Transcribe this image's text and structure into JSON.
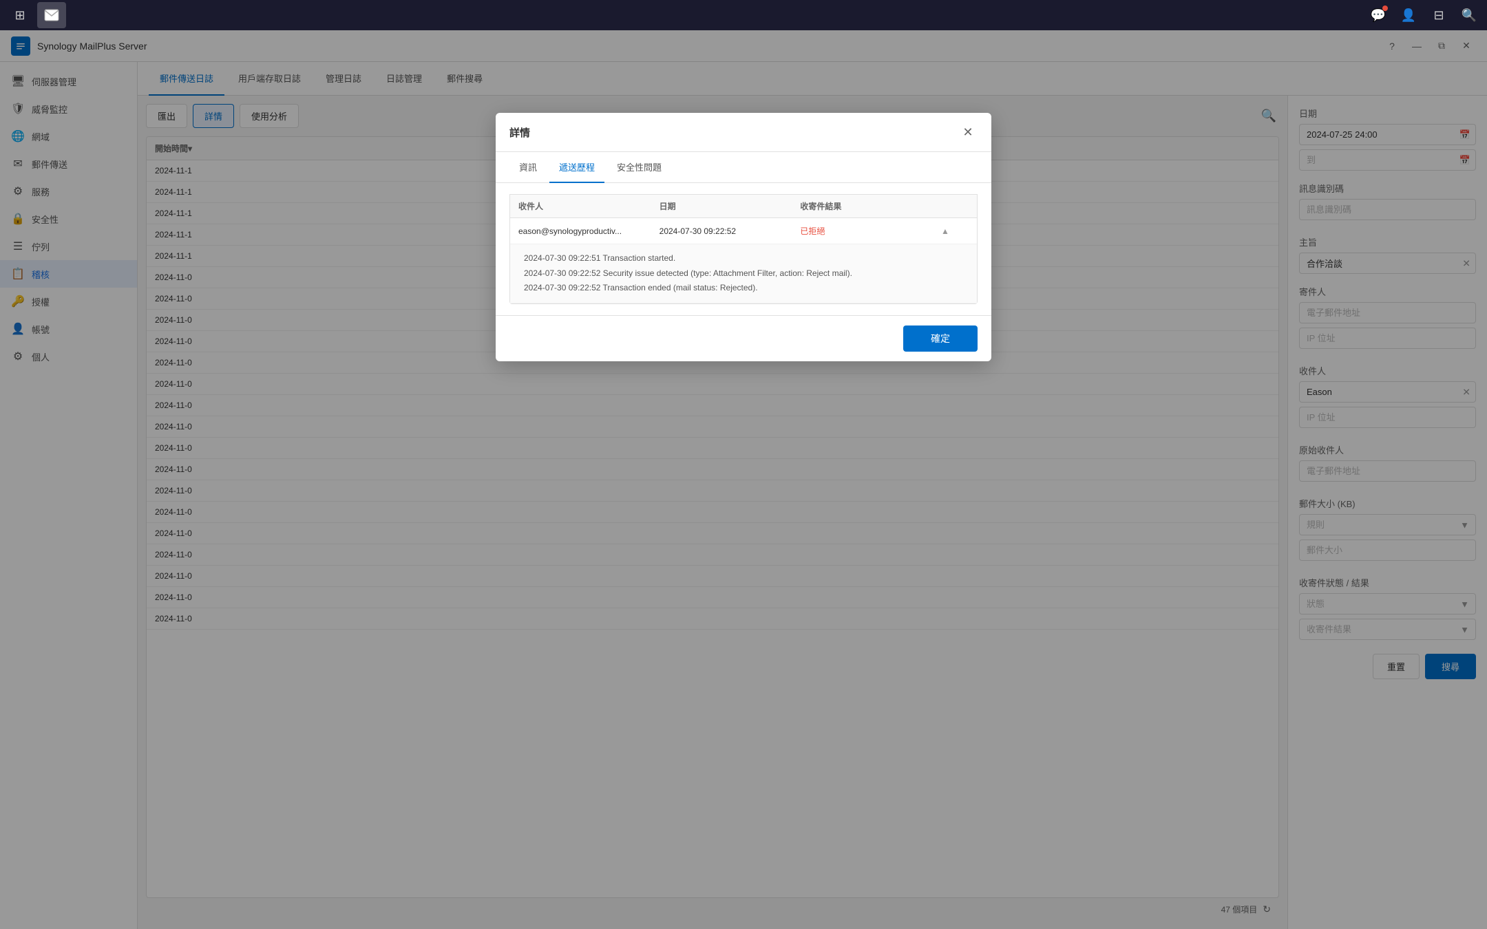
{
  "taskbar": {
    "icons": [
      {
        "name": "grid-icon",
        "symbol": "⊞"
      },
      {
        "name": "mail-icon",
        "symbol": "✉"
      }
    ],
    "rightIcons": [
      {
        "name": "chat-icon",
        "symbol": "💬",
        "hasNotification": true
      },
      {
        "name": "user-icon",
        "symbol": "👤"
      },
      {
        "name": "desktop-icon",
        "symbol": "⊟"
      },
      {
        "name": "search-taskbar-icon",
        "symbol": "🔍"
      }
    ]
  },
  "titleBar": {
    "appName": "Synology MailPlus Server",
    "helpBtn": "?",
    "minimizeBtn": "—",
    "restoreBtn": "⧉",
    "closeBtn": "✕"
  },
  "sidebar": {
    "items": [
      {
        "id": "server-mgmt",
        "label": "伺服器管理",
        "icon": "🖥"
      },
      {
        "id": "threat-monitor",
        "label": "威脅監控",
        "icon": "🛡"
      },
      {
        "id": "domain",
        "label": "網域",
        "icon": "🌐"
      },
      {
        "id": "mail-transfer",
        "label": "郵件傳送",
        "icon": "✉"
      },
      {
        "id": "service",
        "label": "服務",
        "icon": "⚙"
      },
      {
        "id": "security",
        "label": "安全性",
        "icon": "🔒"
      },
      {
        "id": "queue",
        "label": "佇列",
        "icon": "☰"
      },
      {
        "id": "audit",
        "label": "稽核",
        "icon": "📋",
        "active": true
      },
      {
        "id": "auth",
        "label": "授權",
        "icon": "🔑"
      },
      {
        "id": "account",
        "label": "帳號",
        "icon": "👤"
      },
      {
        "id": "personal",
        "label": "個人",
        "icon": "⚙"
      }
    ]
  },
  "navTabs": {
    "tabs": [
      {
        "id": "mail-transfer-log",
        "label": "郵件傳送日誌",
        "active": true
      },
      {
        "id": "user-store-log",
        "label": "用戶端存取日誌"
      },
      {
        "id": "mgmt-log",
        "label": "管理日誌"
      },
      {
        "id": "log-mgmt",
        "label": "日誌管理"
      },
      {
        "id": "mail-search",
        "label": "郵件搜尋"
      }
    ]
  },
  "toolbar": {
    "exportBtn": "匯出",
    "detailBtn": "詳情",
    "analysisBtn": "使用分析",
    "searchIcon": "🔍"
  },
  "logTable": {
    "columns": [
      "開始時間▾",
      "",
      "",
      ""
    ],
    "rows": [
      {
        "date": "2024-11-1"
      },
      {
        "date": "2024-11-1"
      },
      {
        "date": "2024-11-1"
      },
      {
        "date": "2024-11-1"
      },
      {
        "date": "2024-11-1"
      },
      {
        "date": "2024-11-0"
      },
      {
        "date": "2024-11-0"
      },
      {
        "date": "2024-11-0"
      },
      {
        "date": "2024-11-0"
      },
      {
        "date": "2024-11-0"
      },
      {
        "date": "2024-11-0"
      },
      {
        "date": "2024-11-0"
      },
      {
        "date": "2024-11-0"
      },
      {
        "date": "2024-11-0"
      },
      {
        "date": "2024-11-0"
      },
      {
        "date": "2024-11-0"
      },
      {
        "date": "2024-11-0"
      },
      {
        "date": "2024-11-0"
      },
      {
        "date": "2024-11-0"
      },
      {
        "date": "2024-11-0"
      },
      {
        "date": "2024-11-0"
      },
      {
        "date": "2024-11-0"
      }
    ],
    "footer": {
      "count": "47 個項目",
      "refreshIcon": "↻"
    }
  },
  "rightPanel": {
    "dateLabel": "日期",
    "dateFrom": "2024-07-25 24:00",
    "dateTo": "到",
    "msgIdLabel": "訊息識別碼",
    "msgIdPlaceholder": "訊息識別碼",
    "subjectLabel": "主旨",
    "subjectValue": "合作洽談",
    "senderLabel": "寄件人",
    "senderEmailPlaceholder": "電子郵件地址",
    "senderIpPlaceholder": "IP 位址",
    "recipientLabel": "收件人",
    "recipientValue": "Eason",
    "recipientIpPlaceholder": "IP 位址",
    "originalRecipientLabel": "原始收件人",
    "originalRecipientPlaceholder": "電子郵件地址",
    "mailSizeLabel": "郵件大小 (KB)",
    "mailSizeRulePlaceholder": "規則",
    "mailSizePlaceholder": "郵件大小",
    "deliveryStatusLabel": "收寄件狀態 / 結果",
    "statusPlaceholder": "狀態",
    "resultPlaceholder": "收寄件結果",
    "resetBtn": "重置",
    "searchBtn": "搜尋"
  },
  "modal": {
    "title": "詳情",
    "closeBtn": "✕",
    "tabs": [
      {
        "id": "info",
        "label": "資訊"
      },
      {
        "id": "delivery",
        "label": "遞送歷程",
        "active": true
      },
      {
        "id": "security",
        "label": "安全性問題"
      }
    ],
    "tableColumns": [
      "收件人",
      "日期",
      "收寄件結果",
      ""
    ],
    "tableRows": [
      {
        "recipient": "eason@synologyproductiv...",
        "date": "2024-07-30 09:22:52",
        "result": "已拒絕",
        "expanded": true,
        "details": [
          "2024-07-30 09:22:51  Transaction started.",
          "2024-07-30 09:22:52  Security issue detected (type: Attachment Filter, action: Reject mail).",
          "2024-07-30 09:22:52  Transaction ended (mail status: Rejected)."
        ]
      }
    ],
    "confirmBtn": "確定"
  }
}
